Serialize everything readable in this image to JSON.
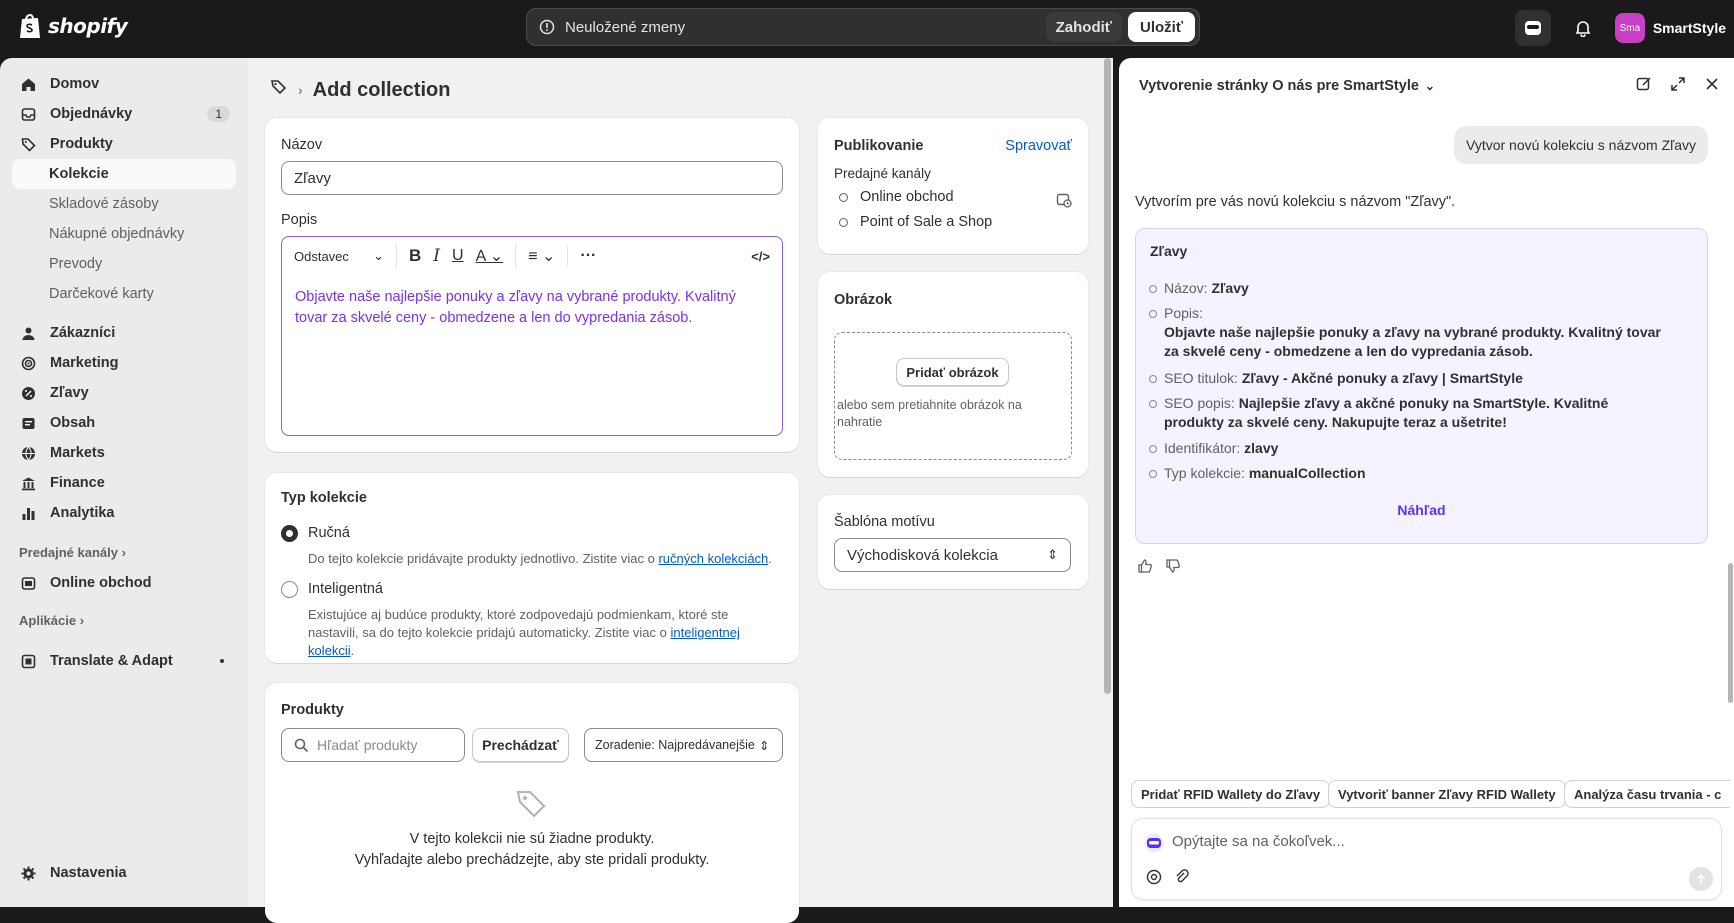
{
  "topbar": {
    "brand": "shopify",
    "unsaved_text": "Neuložené zmeny",
    "discard_label": "Zahodiť",
    "save_label": "Uložiť",
    "store_initials": "Sma",
    "store_name": "SmartStyle"
  },
  "sidebar": {
    "items": [
      {
        "label": "Domov",
        "icon": "home-icon"
      },
      {
        "label": "Objednávky",
        "icon": "orders-icon",
        "badge": "1"
      },
      {
        "label": "Produkty",
        "icon": "tag-icon"
      }
    ],
    "sub_items": [
      "Kolekcie",
      "Skladové zásoby",
      "Nákupné objednávky",
      "Prevody",
      "Darčekové karty"
    ],
    "items2": [
      {
        "label": "Zákazníci",
        "icon": "person-icon"
      },
      {
        "label": "Marketing",
        "icon": "target-icon"
      },
      {
        "label": "Zľavy",
        "icon": "discount-icon"
      },
      {
        "label": "Obsah",
        "icon": "content-icon"
      },
      {
        "label": "Markets",
        "icon": "globe-icon"
      },
      {
        "label": "Finance",
        "icon": "bank-icon"
      },
      {
        "label": "Analytika",
        "icon": "chart-icon"
      }
    ],
    "sales_channels_label": "Predajné kanály",
    "online_store": "Online obchod",
    "apps_label": "Aplikácie",
    "app_item": "Translate & Adapt",
    "settings": "Nastavenia"
  },
  "main": {
    "title": "Add collection",
    "name_label": "Názov",
    "name_value": "Zľavy",
    "desc_label": "Popis",
    "paragraph_select": "Odstavec",
    "description": "Objavte naše najlepšie ponuky a zľavy na vybrané produkty. Kvalitný tovar za skvelé ceny - obmedzene a len do vypredania zásob.",
    "type_title": "Typ kolekcie",
    "manual_label": "Ručná",
    "manual_help": "Do tejto kolekcie pridávajte produkty jednotlivo. Zistite viac o ",
    "manual_link": "ručných kolekciách",
    "smart_label": "Inteligentná",
    "smart_help": "Existujúce aj budúce produkty, ktoré zodpovedajú podmienkam, ktoré ste nastavili, sa do tejto kolekcie pridajú automaticky. Zistite viac o ",
    "smart_link": "inteligentnej kolekcii",
    "products_title": "Produkty",
    "search_placeholder": "Hľadať produkty",
    "browse_label": "Prechádzať",
    "sort_label": "Zoradenie: Najpredávanejšie",
    "empty_line1": "V tejto kolekcii nie sú žiadne produkty.",
    "empty_line2": "Vyhľadajte alebo prechádzejte, aby ste pridali produkty."
  },
  "right": {
    "publishing_title": "Publikovanie",
    "manage_label": "Spravovať",
    "channels_label": "Predajné kanály",
    "channels": [
      "Online obchod",
      "Point of Sale a Shop"
    ],
    "image_title": "Obrázok",
    "add_image": "Pridať obrázok",
    "drop_hint": "alebo sem pretiahnite obrázok na nahratie",
    "template_title": "Šablóna motívu",
    "template_value": "Východisková kolekcia"
  },
  "panel": {
    "title": "Vytvorenie stránky O nás pre SmartStyle",
    "user_msg": "Vytvor novú kolekciu s názvom Zľavy",
    "reply": "Vytvorím pre vás novú kolekciu s názvom \"Zľavy\".",
    "card_title": "Zľavy",
    "rows": {
      "name_k": "Názov: ",
      "name_v": "Zľavy",
      "desc_k": "Popis:",
      "desc_v": "Objavte naše najlepšie ponuky a zľavy na vybrané produkty. Kvalitný tovar za skvelé ceny - obmedzene a len do vypredania zásob.",
      "seo_t_k": "SEO titulok: ",
      "seo_t_v": "Zľavy - Akčné ponuky a zľavy | SmartStyle",
      "seo_d_k": "SEO popis: ",
      "seo_d_v": "Najlepšie zľavy a akčné ponuky na SmartStyle. Kvalitné produkty za skvelé ceny. Nakupujte teraz a ušetrite!",
      "id_k": "Identifikátor: ",
      "id_v": "zlavy",
      "type_k": "Typ kolekcie: ",
      "type_v": "manualCollection"
    },
    "preview_label": "Náhľad",
    "suggestions": [
      "Pridať RFID Wallety do Zľavy",
      "Vytvoriť banner Zľavy RFID Wallety",
      "Analýza času trvania - c"
    ],
    "ask_placeholder": "Opýtajte sa na čokoľvek..."
  },
  "colors": {
    "accent": "#5a31f4",
    "link": "#005bd3",
    "editor_text": "#7b2ff0",
    "avatar": "#c83ec5"
  }
}
